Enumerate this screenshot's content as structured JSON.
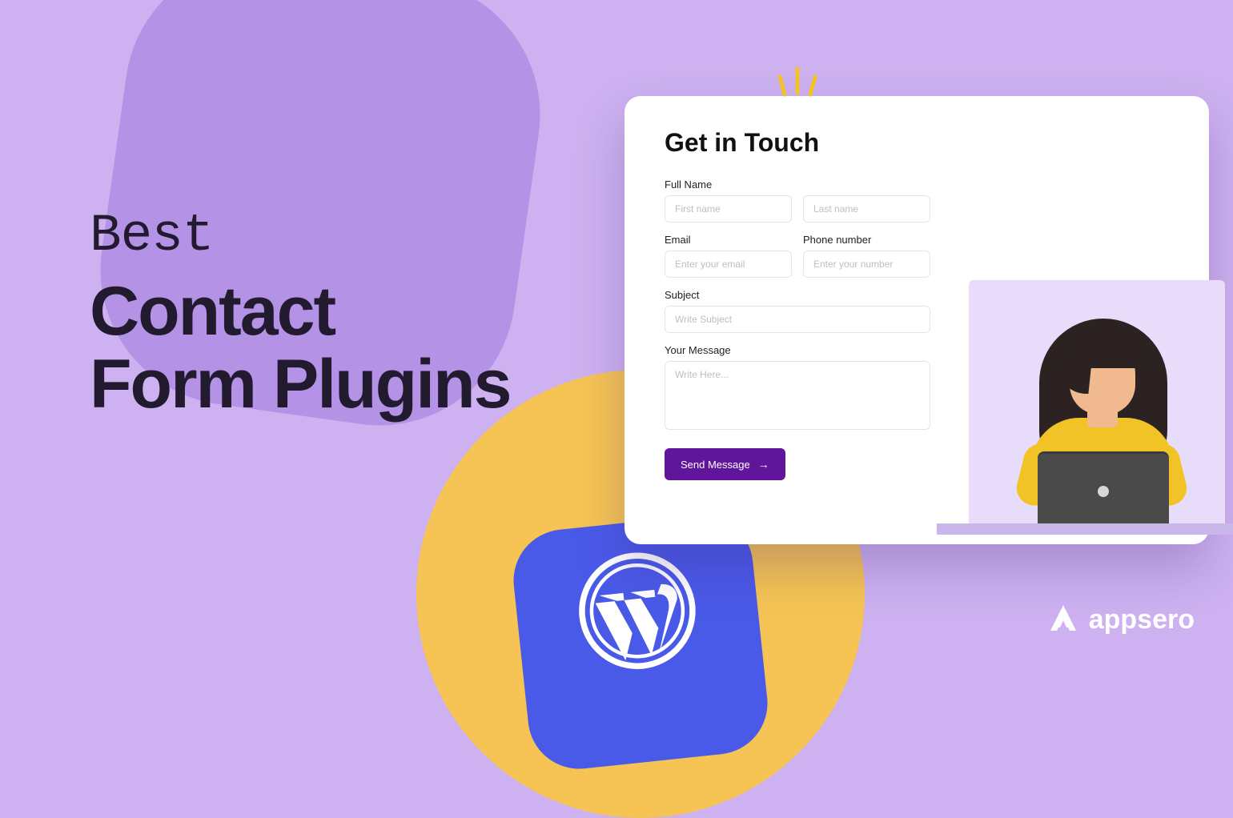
{
  "headline": {
    "line1": "Best",
    "line2": "Contact",
    "line3": "Form Plugins"
  },
  "form": {
    "title": "Get in Touch",
    "fullname_label": "Full Name",
    "firstname_ph": "First name",
    "lastname_ph": "Last name",
    "email_label": "Email",
    "email_ph": "Enter your email",
    "phone_label": "Phone number",
    "phone_ph": "Enter your number",
    "subject_label": "Subject",
    "subject_ph": "Write Subject",
    "message_label": "Your Message",
    "message_ph": "Write Here...",
    "submit_label": "Send Message"
  },
  "brand": {
    "name": "appsero"
  },
  "icons": {
    "wp": "wordpress-icon",
    "spark": "spark-icon",
    "arrow": "arrow-right-icon",
    "brand": "appsero-icon"
  },
  "colors": {
    "bg": "#cdb1f0",
    "accent": "#5f169b",
    "yellow": "#f5c454",
    "wp_blue": "#4a5ae8"
  }
}
